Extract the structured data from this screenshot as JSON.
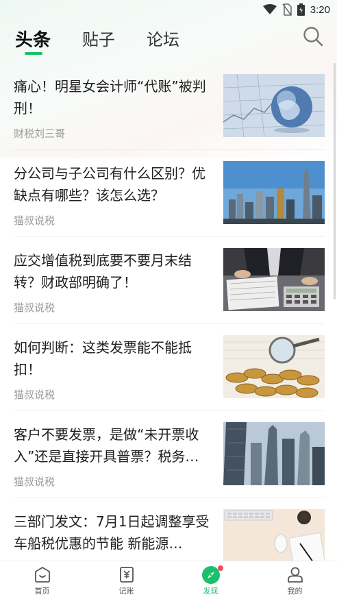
{
  "status_bar": {
    "time": "3:20",
    "icons": [
      "wifi-icon",
      "no-sim-icon",
      "battery-icon"
    ]
  },
  "tabs": [
    {
      "label": "头条",
      "active": true
    },
    {
      "label": "贴子",
      "active": false
    },
    {
      "label": "论坛",
      "active": false
    }
  ],
  "search": {
    "icon": "search-icon"
  },
  "feed": [
    {
      "title": "痛心！明星女会计师“代账”被判刑！",
      "source": "财税刘三哥",
      "thumb": "globe-chart"
    },
    {
      "title": "分公司与子公司有什么区别？优缺点有哪些？该怎么选？",
      "source": "猫叔说税",
      "thumb": "city-skyline"
    },
    {
      "title": "应交增值税到底要不要月末结转？财政部明确了！",
      "source": "猫叔说税",
      "thumb": "calculator-desk"
    },
    {
      "title": "如何判断：这类发票能不能抵扣！",
      "source": "猫叔说税",
      "thumb": "coins-magnifier"
    },
    {
      "title": "客户不要发票，是做“未开票收入”还是直接开具普票？税务…",
      "source": "猫叔说税",
      "thumb": "skyscrapers"
    },
    {
      "title": "三部门发文：7月1日起调整享受车船税优惠的节能 新能源…",
      "source": "",
      "thumb": "keyboard-notebook"
    }
  ],
  "bottom_nav": [
    {
      "label": "首页",
      "icon": "home-icon",
      "active": false
    },
    {
      "label": "记账",
      "icon": "ledger-icon",
      "active": false
    },
    {
      "label": "发现",
      "icon": "compass-icon",
      "active": true,
      "badge": true
    },
    {
      "label": "我的",
      "icon": "user-icon",
      "active": false
    }
  ],
  "colors": {
    "accent": "#1cbf6b",
    "badge": "#f24a5a",
    "source_text": "#9a9a9a"
  }
}
